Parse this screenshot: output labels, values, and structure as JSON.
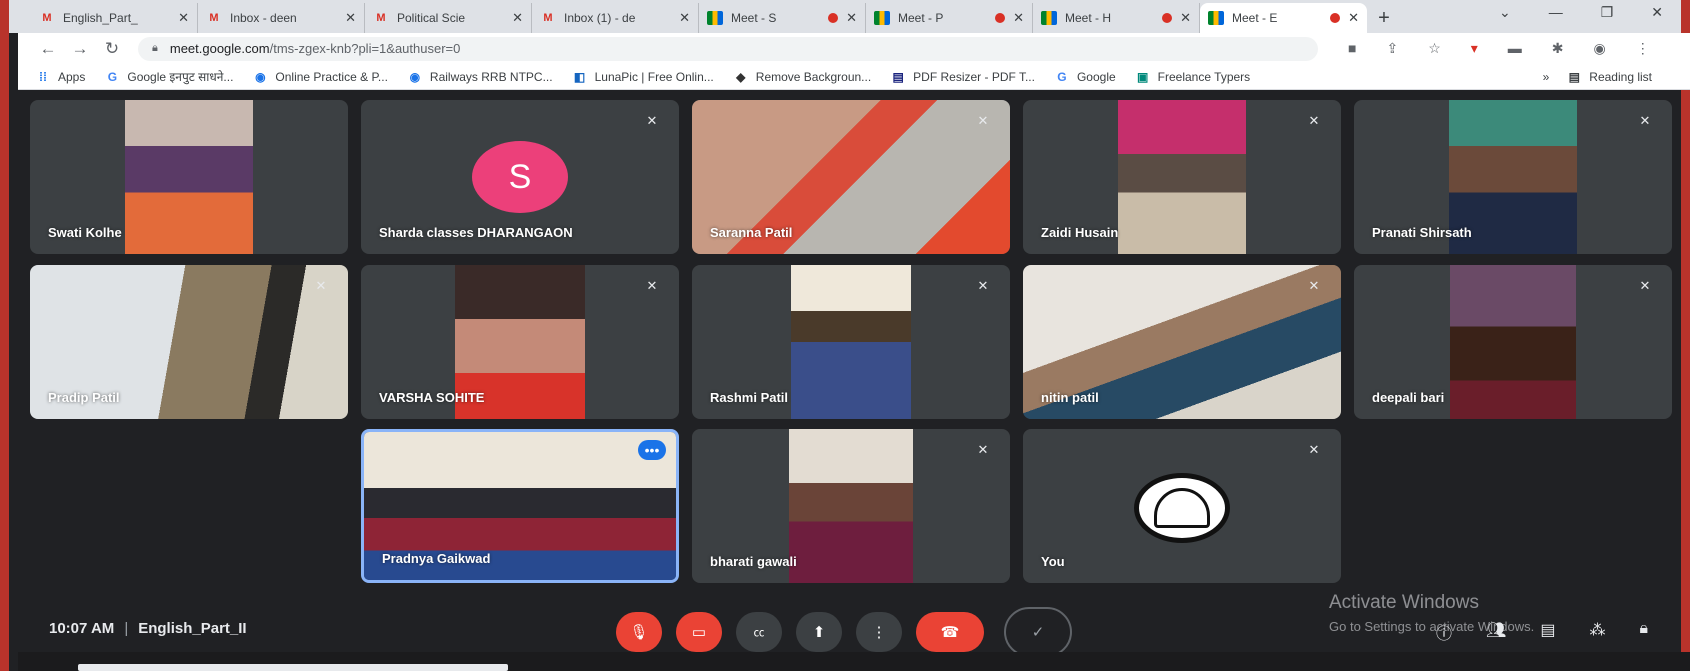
{
  "browser": {
    "tabs": [
      {
        "label": "English_Part_",
        "favicon": "gmail-icon"
      },
      {
        "label": "Inbox - deen",
        "favicon": "gmail-icon"
      },
      {
        "label": "Political Scie",
        "favicon": "gmail-icon"
      },
      {
        "label": "Inbox (1) - de",
        "favicon": "gmail-icon"
      },
      {
        "label": "Meet - S",
        "favicon": "meet-icon"
      },
      {
        "label": "Meet - P",
        "favicon": "meet-icon"
      },
      {
        "label": "Meet - H",
        "favicon": "meet-icon"
      },
      {
        "label": "Meet - E",
        "favicon": "meet-icon"
      }
    ],
    "url_host": "meet.google.com",
    "url_path": "/tms-zgex-knb?pli=1&authuser=0",
    "bookmarks": [
      {
        "label": "Apps",
        "icon": "apps-grid-icon"
      },
      {
        "label": "Google इनपुट साधने...",
        "icon": "google-icon"
      },
      {
        "label": "Online Practice & P...",
        "icon": "globe-icon"
      },
      {
        "label": "Railways RRB NTPC...",
        "icon": "globe-icon"
      },
      {
        "label": "LunaPic | Free Onlin...",
        "icon": "lunapic-icon"
      },
      {
        "label": "Remove Backgroun...",
        "icon": "removebg-icon"
      },
      {
        "label": "PDF Resizer - PDF T...",
        "icon": "pdf-icon"
      },
      {
        "label": "Google",
        "icon": "google-icon"
      },
      {
        "label": "Freelance Typers",
        "icon": "site-icon"
      }
    ],
    "reading_list": "Reading list"
  },
  "meet": {
    "participants": [
      {
        "name": "Swati Kolhe"
      },
      {
        "name": "Sharda classes DHARANGAON",
        "avatar_letter": "S"
      },
      {
        "name": "Saranna Patil"
      },
      {
        "name": "Zaidi Husain"
      },
      {
        "name": "Pranati Shirsath"
      },
      {
        "name": "Pradip Patil"
      },
      {
        "name": "VARSHA SOHITE"
      },
      {
        "name": "Rashmi Patil"
      },
      {
        "name": "nitin patil"
      },
      {
        "name": "deepali bari"
      },
      {
        "name": "Pradnya Gaikwad"
      },
      {
        "name": "bharati gawali"
      },
      {
        "name": "You"
      }
    ],
    "time": "10:07 AM",
    "meeting_name": "English_Part_II",
    "watermark_title": "Activate Windows",
    "watermark_sub": "Go to Settings to activate Windows."
  }
}
